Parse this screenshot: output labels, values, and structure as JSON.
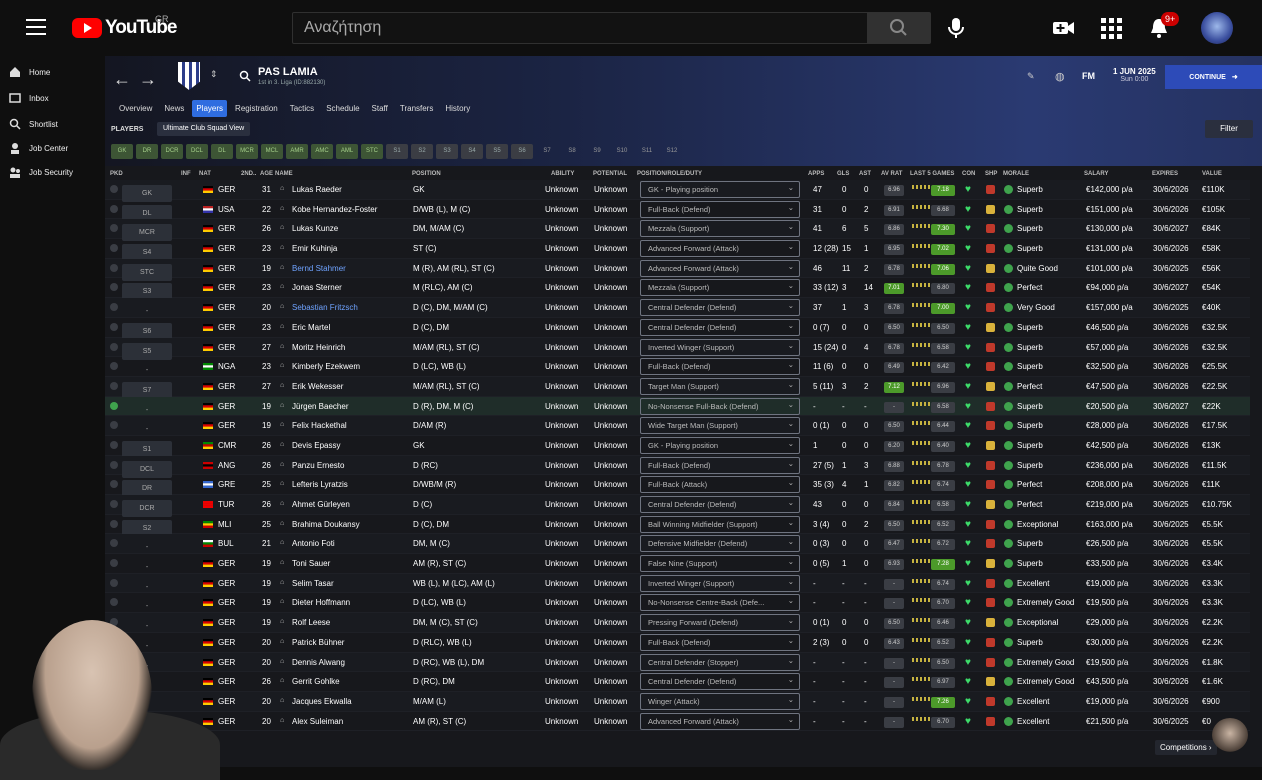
{
  "youtube": {
    "logo": "YouTube",
    "country": "GR",
    "search_placeholder": "Αναζήτηση",
    "badge": "9+"
  },
  "sidebar": [
    {
      "label": "Home",
      "icon": "home-icon"
    },
    {
      "label": "Inbox",
      "icon": "inbox-icon"
    },
    {
      "label": "Shortlist",
      "icon": "search-icon"
    },
    {
      "label": "Job Center",
      "icon": "job-center-icon"
    },
    {
      "label": "Job Security",
      "icon": "job-security-icon"
    }
  ],
  "club": {
    "name": "PAS LAMIA",
    "subtitle": "1st in 3. Liga (ID:882130)"
  },
  "date": {
    "main": "1 JUN 2025",
    "sub": "Sun 0:00"
  },
  "continue_label": "CONTINUE",
  "fm_label": "FM",
  "tabs": [
    "Overview",
    "News",
    "Players",
    "Registration",
    "Tactics",
    "Schedule",
    "Staff",
    "Transfers",
    "History"
  ],
  "players_title": "PLAYERS",
  "view": "Ultimate Club Squad View",
  "filter_label": "Filter",
  "pos_filters": [
    "GK",
    "DR",
    "DCR",
    "DCL",
    "DL",
    "MCR",
    "MCL",
    "AMR",
    "AMC",
    "AML",
    "STC",
    "S1",
    "S2",
    "S3",
    "S4",
    "S5",
    "S6",
    "S7",
    "S8",
    "S9",
    "S10",
    "S11",
    "S12"
  ],
  "columns": {
    "pkd": "PKD",
    "inf": "INF",
    "nat": "NAT",
    "second": "2ND..",
    "age": "AGE",
    "name": "NAME",
    "position": "POSITION",
    "ability": "ABILITY",
    "potential": "POTENTIAL",
    "role": "POSITION/ROLE/DUTY",
    "apps": "APPS",
    "gls": "GLS",
    "ast": "AST",
    "avrat": "AV RAT",
    "last5": "LAST 5 GAMES",
    "con": "CON",
    "shp": "SHP",
    "morale": "MORALE",
    "salary": "SALARY",
    "expires": "EXPIRES",
    "value": "VALUE"
  },
  "players": [
    {
      "pos": "GK",
      "nat": "GER",
      "age": "31",
      "name": "Lukas Raeder",
      "position": "GK",
      "ability": "Unknown",
      "potential": "Unknown",
      "role": "GK - Playing position",
      "apps": "47",
      "gls": "0",
      "ast": "0",
      "avrat": "6.96",
      "last": "7.18",
      "morale": "Superb",
      "salary": "€142,000 p/a",
      "expires": "30/6/2026",
      "value": "€110K"
    },
    {
      "pos": "DL",
      "nat": "USA",
      "age": "22",
      "name": "Kobe Hernandez-Foster",
      "position": "D/WB (L), M (C)",
      "ability": "Unknown",
      "potential": "Unknown",
      "role": "Full-Back (Defend)",
      "apps": "31",
      "gls": "0",
      "ast": "2",
      "avrat": "6.91",
      "last": "6.68",
      "morale": "Superb",
      "salary": "€151,000 p/a",
      "expires": "30/6/2026",
      "value": "€105K"
    },
    {
      "pos": "MCR",
      "nat": "GER",
      "age": "26",
      "name": "Lukas Kunze",
      "position": "DM, M/AM (C)",
      "ability": "Unknown",
      "potential": "Unknown",
      "role": "Mezzala (Support)",
      "apps": "41",
      "gls": "6",
      "ast": "5",
      "avrat": "6.86",
      "last": "7.30",
      "morale": "Superb",
      "salary": "€130,000 p/a",
      "expires": "30/6/2027",
      "value": "€84K"
    },
    {
      "pos": "S4",
      "nat": "GER",
      "age": "23",
      "name": "Emir Kuhinja",
      "position": "ST (C)",
      "ability": "Unknown",
      "potential": "Unknown",
      "role": "Advanced Forward (Attack)",
      "apps": "12 (28)",
      "gls": "15",
      "ast": "1",
      "avrat": "6.95",
      "last": "7.02",
      "morale": "Superb",
      "salary": "€131,000 p/a",
      "expires": "30/6/2026",
      "value": "€58K"
    },
    {
      "pos": "STC",
      "nat": "GER",
      "age": "19",
      "name": "Bernd Stahmer",
      "position": "M (R), AM (RL), ST (C)",
      "ability": "Unknown",
      "potential": "Unknown",
      "role": "Advanced Forward (Attack)",
      "apps": "46",
      "gls": "11",
      "ast": "2",
      "avrat": "6.78",
      "last": "7.06",
      "morale": "Quite Good",
      "salary": "€101,000 p/a",
      "expires": "30/6/2025",
      "value": "€56K"
    },
    {
      "pos": "S3",
      "nat": "GER",
      "age": "23",
      "name": "Jonas Sterner",
      "position": "M (RLC), AM (C)",
      "ability": "Unknown",
      "potential": "Unknown",
      "role": "Mezzala (Support)",
      "apps": "33 (12)",
      "gls": "3",
      "ast": "14",
      "avrat": "7.01",
      "last": "6.80",
      "morale": "Perfect",
      "salary": "€94,000 p/a",
      "expires": "30/6/2027",
      "value": "€54K"
    },
    {
      "pos": "-",
      "nat": "GER",
      "age": "20",
      "name": "Sebastian Fritzsch",
      "position": "D (C), DM, M/AM (C)",
      "ability": "Unknown",
      "potential": "Unknown",
      "role": "Central Defender (Defend)",
      "apps": "37",
      "gls": "1",
      "ast": "3",
      "avrat": "6.78",
      "last": "7.00",
      "morale": "Very Good",
      "salary": "€157,000 p/a",
      "expires": "30/6/2025",
      "value": "€40K"
    },
    {
      "pos": "S6",
      "nat": "GER",
      "age": "23",
      "name": "Eric Martel",
      "position": "D (C), DM",
      "ability": "Unknown",
      "potential": "Unknown",
      "role": "Central Defender (Defend)",
      "apps": "0 (7)",
      "gls": "0",
      "ast": "0",
      "avrat": "6.50",
      "last": "6.50",
      "morale": "Superb",
      "salary": "€46,500 p/a",
      "expires": "30/6/2026",
      "value": "€32.5K"
    },
    {
      "pos": "S5",
      "nat": "GER",
      "age": "27",
      "name": "Moritz Heinrich",
      "position": "M/AM (RL), ST (C)",
      "ability": "Unknown",
      "potential": "Unknown",
      "role": "Inverted Winger (Support)",
      "apps": "15 (24)",
      "gls": "0",
      "ast": "4",
      "avrat": "6.78",
      "last": "6.58",
      "morale": "Superb",
      "salary": "€57,000 p/a",
      "expires": "30/6/2026",
      "value": "€32.5K"
    },
    {
      "pos": "-",
      "nat": "NGA",
      "age": "23",
      "name": "Kimberly Ezekwem",
      "position": "D (LC), WB (L)",
      "ability": "Unknown",
      "potential": "Unknown",
      "role": "Full-Back (Defend)",
      "apps": "11 (6)",
      "gls": "0",
      "ast": "0",
      "avrat": "6.49",
      "last": "6.42",
      "morale": "Superb",
      "salary": "€32,500 p/a",
      "expires": "30/6/2026",
      "value": "€25.5K"
    },
    {
      "pos": "S7",
      "nat": "GER",
      "age": "27",
      "name": "Erik Wekesser",
      "position": "M/AM (RL), ST (C)",
      "ability": "Unknown",
      "potential": "Unknown",
      "role": "Target Man (Support)",
      "apps": "5 (11)",
      "gls": "3",
      "ast": "2",
      "avrat": "7.12",
      "last": "6.96",
      "morale": "Perfect",
      "salary": "€47,500 p/a",
      "expires": "30/6/2026",
      "value": "€22.5K"
    },
    {
      "pos": "-",
      "nat": "GER",
      "age": "19",
      "name": "Jürgen Baecher",
      "position": "D (R), DM, M (C)",
      "ability": "Unknown",
      "potential": "Unknown",
      "role": "No-Nonsense Full-Back (Defend)",
      "apps": "-",
      "gls": "-",
      "ast": "-",
      "avrat": "-",
      "last": "6.58",
      "morale": "Superb",
      "salary": "€20,500 p/a",
      "expires": "30/6/2027",
      "value": "€22K"
    },
    {
      "pos": "-",
      "nat": "GER",
      "age": "19",
      "name": "Felix Hackethal",
      "position": "D/AM (R)",
      "ability": "Unknown",
      "potential": "Unknown",
      "role": "Wide Target Man (Support)",
      "apps": "0 (1)",
      "gls": "0",
      "ast": "0",
      "avrat": "6.50",
      "last": "6.44",
      "morale": "Superb",
      "salary": "€28,000 p/a",
      "expires": "30/6/2026",
      "value": "€17.5K"
    },
    {
      "pos": "S1",
      "nat": "CMR",
      "age": "26",
      "name": "Devis Epassy",
      "position": "GK",
      "ability": "Unknown",
      "potential": "Unknown",
      "role": "GK - Playing position",
      "apps": "1",
      "gls": "0",
      "ast": "0",
      "avrat": "6.20",
      "last": "6.40",
      "morale": "Superb",
      "salary": "€42,500 p/a",
      "expires": "30/6/2026",
      "value": "€13K"
    },
    {
      "pos": "DCL",
      "nat": "ANG",
      "age": "26",
      "name": "Panzu Ernesto",
      "position": "D (RC)",
      "ability": "Unknown",
      "potential": "Unknown",
      "role": "Full-Back (Defend)",
      "apps": "27 (5)",
      "gls": "1",
      "ast": "3",
      "avrat": "6.88",
      "last": "6.78",
      "morale": "Superb",
      "salary": "€236,000 p/a",
      "expires": "30/6/2026",
      "value": "€11.5K"
    },
    {
      "pos": "DR",
      "nat": "GRE",
      "age": "25",
      "name": "Lefteris Lyratzis",
      "position": "D/WB/M (R)",
      "ability": "Unknown",
      "potential": "Unknown",
      "role": "Full-Back (Attack)",
      "apps": "35 (3)",
      "gls": "4",
      "ast": "1",
      "avrat": "6.82",
      "last": "6.74",
      "morale": "Perfect",
      "salary": "€208,000 p/a",
      "expires": "30/6/2026",
      "value": "€11K"
    },
    {
      "pos": "DCR",
      "nat": "TUR",
      "age": "26",
      "name": "Ahmet Gürleyen",
      "position": "D (C)",
      "ability": "Unknown",
      "potential": "Unknown",
      "role": "Central Defender (Defend)",
      "apps": "43",
      "gls": "0",
      "ast": "0",
      "avrat": "6.84",
      "last": "6.58",
      "morale": "Perfect",
      "salary": "€219,000 p/a",
      "expires": "30/6/2025",
      "value": "€10.75K"
    },
    {
      "pos": "S2",
      "nat": "MLI",
      "age": "25",
      "name": "Brahima Doukansy",
      "position": "D (C), DM",
      "ability": "Unknown",
      "potential": "Unknown",
      "role": "Ball Winning Midfielder (Support)",
      "apps": "3 (4)",
      "gls": "0",
      "ast": "2",
      "avrat": "6.50",
      "last": "6.52",
      "morale": "Exceptional",
      "salary": "€163,000 p/a",
      "expires": "30/6/2025",
      "value": "€5.5K"
    },
    {
      "pos": "-",
      "nat": "BUL",
      "age": "21",
      "name": "Antonio Foti",
      "position": "DM, M (C)",
      "ability": "Unknown",
      "potential": "Unknown",
      "role": "Defensive Midfielder (Defend)",
      "apps": "0 (3)",
      "gls": "0",
      "ast": "0",
      "avrat": "6.47",
      "last": "6.72",
      "morale": "Superb",
      "salary": "€26,500 p/a",
      "expires": "30/6/2026",
      "value": "€5.5K"
    },
    {
      "pos": "-",
      "nat": "GER",
      "age": "19",
      "name": "Toni Sauer",
      "position": "AM (R), ST (C)",
      "ability": "Unknown",
      "potential": "Unknown",
      "role": "False Nine (Support)",
      "apps": "0 (5)",
      "gls": "1",
      "ast": "0",
      "avrat": "6.93",
      "last": "7.28",
      "morale": "Superb",
      "salary": "€33,500 p/a",
      "expires": "30/6/2026",
      "value": "€3.4K"
    },
    {
      "pos": "-",
      "nat": "GER",
      "age": "19",
      "name": "Selim Tasar",
      "position": "WB (L), M (LC), AM (L)",
      "ability": "Unknown",
      "potential": "Unknown",
      "role": "Inverted Winger (Support)",
      "apps": "-",
      "gls": "-",
      "ast": "-",
      "avrat": "-",
      "last": "6.74",
      "morale": "Excellent",
      "salary": "€19,000 p/a",
      "expires": "30/6/2026",
      "value": "€3.3K"
    },
    {
      "pos": "-",
      "nat": "GER",
      "age": "19",
      "name": "Dieter Hoffmann",
      "position": "D (LC), WB (L)",
      "ability": "Unknown",
      "potential": "Unknown",
      "role": "No-Nonsense Centre-Back (Defe...",
      "apps": "-",
      "gls": "-",
      "ast": "-",
      "avrat": "-",
      "last": "6.70",
      "morale": "Extremely Good",
      "salary": "€19,500 p/a",
      "expires": "30/6/2026",
      "value": "€3.3K"
    },
    {
      "pos": "-",
      "nat": "GER",
      "age": "19",
      "name": "Rolf Leese",
      "position": "DM, M (C), ST (C)",
      "ability": "Unknown",
      "potential": "Unknown",
      "role": "Pressing Forward (Defend)",
      "apps": "0 (1)",
      "gls": "0",
      "ast": "0",
      "avrat": "6.50",
      "last": "6.46",
      "morale": "Exceptional",
      "salary": "€29,000 p/a",
      "expires": "30/6/2026",
      "value": "€2.2K"
    },
    {
      "pos": "-",
      "nat": "GER",
      "age": "20",
      "name": "Patrick Bühner",
      "position": "D (RLC), WB (L)",
      "ability": "Unknown",
      "potential": "Unknown",
      "role": "Full-Back (Defend)",
      "apps": "2 (3)",
      "gls": "0",
      "ast": "0",
      "avrat": "6.43",
      "last": "6.52",
      "morale": "Superb",
      "salary": "€30,000 p/a",
      "expires": "30/6/2026",
      "value": "€2.2K"
    },
    {
      "pos": "-",
      "nat": "GER",
      "age": "20",
      "name": "Dennis Alwang",
      "position": "D (RC), WB (L), DM",
      "ability": "Unknown",
      "potential": "Unknown",
      "role": "Central Defender (Stopper)",
      "apps": "-",
      "gls": "-",
      "ast": "-",
      "avrat": "-",
      "last": "6.50",
      "morale": "Extremely Good",
      "salary": "€19,500 p/a",
      "expires": "30/6/2026",
      "value": "€1.8K"
    },
    {
      "pos": "-",
      "nat": "GER",
      "age": "26",
      "name": "Gerrit Gohlke",
      "position": "D (RC), DM",
      "ability": "Unknown",
      "potential": "Unknown",
      "role": "Central Defender (Defend)",
      "apps": "-",
      "gls": "-",
      "ast": "-",
      "avrat": "-",
      "last": "6.97",
      "morale": "Extremely Good",
      "salary": "€43,500 p/a",
      "expires": "30/6/2026",
      "value": "€1.6K"
    },
    {
      "pos": "-",
      "nat": "GER",
      "age": "20",
      "name": "Jacques Ekwalla",
      "position": "M/AM (L)",
      "ability": "Unknown",
      "potential": "Unknown",
      "role": "Winger (Attack)",
      "apps": "-",
      "gls": "-",
      "ast": "-",
      "avrat": "-",
      "last": "7.26",
      "morale": "Excellent",
      "salary": "€19,000 p/a",
      "expires": "30/6/2026",
      "value": "€900"
    },
    {
      "pos": "-",
      "nat": "GER",
      "age": "20",
      "name": "Alex Suleiman",
      "position": "AM (R), ST (C)",
      "ability": "Unknown",
      "potential": "Unknown",
      "role": "Advanced Forward (Attack)",
      "apps": "-",
      "gls": "-",
      "ast": "-",
      "avrat": "-",
      "last": "6.70",
      "morale": "Excellent",
      "salary": "€21,500 p/a",
      "expires": "30/6/2025",
      "value": "€0"
    }
  ],
  "competitions_label": "Competitions"
}
